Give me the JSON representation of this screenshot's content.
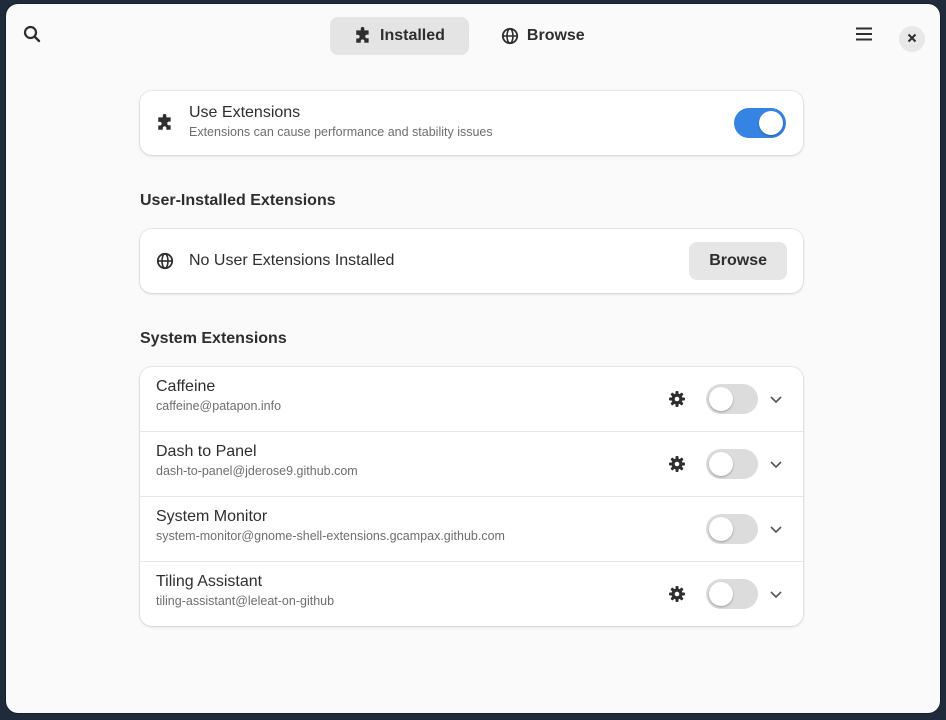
{
  "header": {
    "tabs": [
      {
        "label": "Installed",
        "icon": "puzzle-icon",
        "active": true
      },
      {
        "label": "Browse",
        "icon": "globe-icon",
        "active": false
      }
    ]
  },
  "use_extensions": {
    "title": "Use Extensions",
    "subtitle": "Extensions can cause performance and stability issues",
    "enabled": true
  },
  "user_section": {
    "heading": "User-Installed Extensions",
    "empty_label": "No User Extensions Installed",
    "browse_label": "Browse"
  },
  "system_section": {
    "heading": "System Extensions",
    "extensions": [
      {
        "name": "Caffeine",
        "uuid": "caffeine@patapon.info",
        "has_settings": true,
        "enabled": false
      },
      {
        "name": "Dash to Panel",
        "uuid": "dash-to-panel@jderose9.github.com",
        "has_settings": true,
        "enabled": false
      },
      {
        "name": "System Monitor",
        "uuid": "system-monitor@gnome-shell-extensions.gcampax.github.com",
        "has_settings": false,
        "enabled": false
      },
      {
        "name": "Tiling Assistant",
        "uuid": "tiling-assistant@leleat-on-github",
        "has_settings": true,
        "enabled": false
      }
    ]
  },
  "colors": {
    "accent": "#3584e4",
    "window_bg": "#fafafa",
    "card_bg": "#ffffff"
  }
}
